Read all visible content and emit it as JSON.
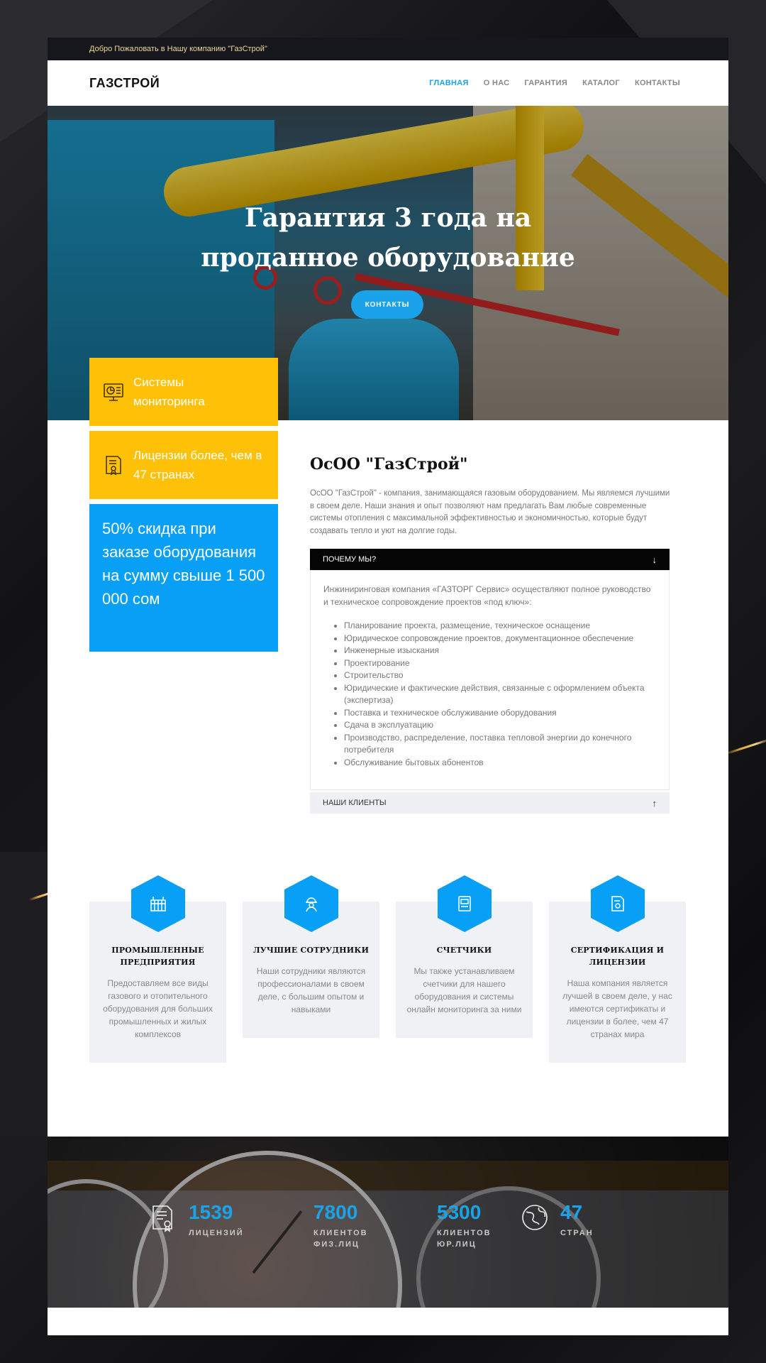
{
  "topbar": {
    "welcome": "Добро Пожаловать в Нашу компанию \"ГазСтрой\""
  },
  "nav": {
    "logo": "ГАЗСТРОЙ",
    "items": [
      "ГЛАВНАЯ",
      "О НАС",
      "ГАРАНТИЯ",
      "КАТАЛОГ",
      "КОНТАКТЫ"
    ]
  },
  "hero": {
    "title": "Гарантия 3 года на проданное оборудование",
    "button": "КОНТАКТЫ"
  },
  "features": {
    "monitoring": "Системы мониторинга",
    "licenses": "Лицензии более, чем в 47 странах",
    "discount": "50% скидка при заказе оборудования на сумму свыше 1 500 000 сом"
  },
  "about": {
    "title": "ОсОО \"ГазСтрой\"",
    "text": "ОсОО \"ГазСтрой\" - компания, занимающаяся газовым оборудованием. Мы являемся лучшими в своем деле. Наши знания и опыт позволяют нам предлагать Вам любые современные системы отопления с максимальной эффективностью и экономичностью, которые будут создавать тепло и уют на долгие годы."
  },
  "accordion": {
    "why_label": "ПОЧЕМУ МЫ?",
    "why_intro": "Инжиниринговая компания «ГАЗТОРГ Сервис» осуществляют полное руководство и техническое сопровождение проектов «под ключ»:",
    "why_items": [
      "Планирование проекта, размещение, техническое оснащение",
      "Юридическое сопровождение проектов, документационное обеспечение",
      "Инженерные изыскания",
      "Проектирование",
      "Строительство",
      "Юридические и фактические действия, связанные с оформлением объекта (экспертиза)",
      "Поставка и техническое обслуживание оборудования",
      "Сдача в эксплуатацию",
      "Производство, распределение, поставка тепловой энергии до конечного потребителя",
      "Обслуживание бытовых абонентов"
    ],
    "clients_label": "НАШИ КЛИЕНТЫ"
  },
  "cards": [
    {
      "title": "ПРОМЫШЛЕННЫЕ ПРЕДПРИЯТИЯ",
      "text": "Предоставляем все виды газового и отопительного оборудования для больших промышленных и жилых комплексов",
      "icon": "factory-icon"
    },
    {
      "title": "ЛУЧШИЕ СОТРУДНИКИ",
      "text": "Наши сотрудники являются профессионалами в своем деле, с большим опытом и навыками",
      "icon": "worker-icon"
    },
    {
      "title": "СЧЕТЧИКИ",
      "text": "Мы также устанавливаем счетчики для нашего оборудования и системы онлайн мониторинга за ними",
      "icon": "meter-icon"
    },
    {
      "title": "СЕРТИФИКАЦИЯ И ЛИЦЕНЗИИ",
      "text": "Наша компания является лучшей в своем деле, у нас имеются сертификаты и лицензии в более, чем 47 странах мира",
      "icon": "certificate-icon"
    }
  ],
  "stats": [
    {
      "num": "1539",
      "label": "ЛИЦЕНЗИЙ"
    },
    {
      "num": "7800",
      "label": "КЛИЕНТОВ ФИЗ.ЛИЦ"
    },
    {
      "num": "5300",
      "label": "КЛИЕНТОВ ЮР.ЛИЦ"
    },
    {
      "num": "47",
      "label": "СТРАН"
    }
  ],
  "colors": {
    "accent": "#1aa3e8",
    "yellow": "#ffc107",
    "blue": "#08a0f7"
  }
}
